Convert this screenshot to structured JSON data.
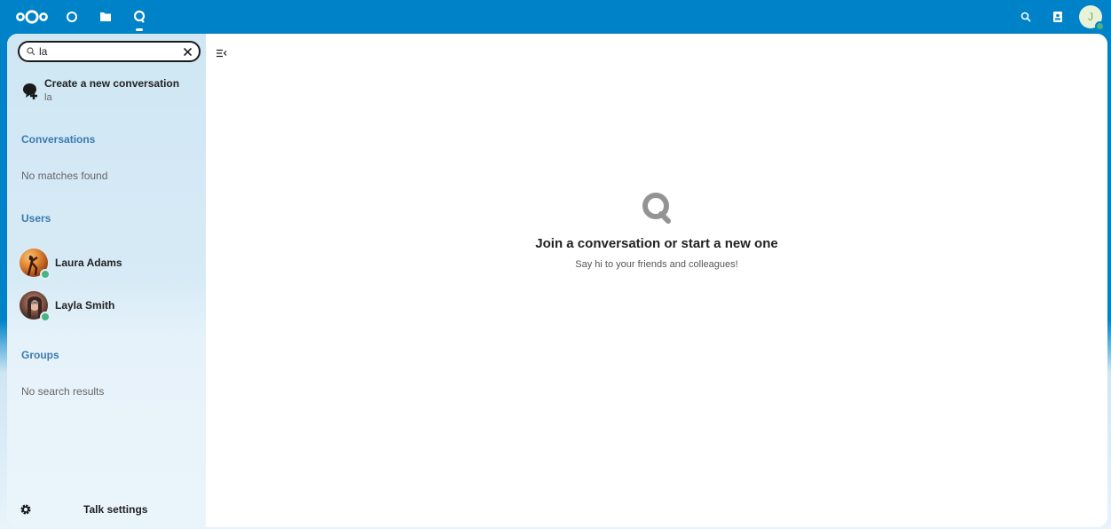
{
  "header": {
    "apps": [
      {
        "icon": "logo-icon"
      },
      {
        "icon": "dashboard-icon"
      },
      {
        "icon": "files-icon"
      },
      {
        "icon": "talk-icon",
        "active": true
      }
    ],
    "user_initial": "J",
    "colors": {
      "brand": "#0082c9",
      "online": "#49b382"
    }
  },
  "sidebar": {
    "search": {
      "value": "la",
      "placeholder": ""
    },
    "new_conversation": {
      "title": "Create a new conversation",
      "subtitle": "la"
    },
    "conversations": {
      "title": "Conversations",
      "empty": "No matches found"
    },
    "users": {
      "title": "Users",
      "items": [
        {
          "name": "Laura Adams"
        },
        {
          "name": "Layla Smith"
        }
      ]
    },
    "groups": {
      "title": "Groups",
      "empty": "No search results"
    },
    "settings": {
      "label": "Talk settings"
    }
  },
  "main": {
    "empty": {
      "title": "Join a conversation or start a new one",
      "subtitle": "Say hi to your friends and colleagues!"
    }
  }
}
